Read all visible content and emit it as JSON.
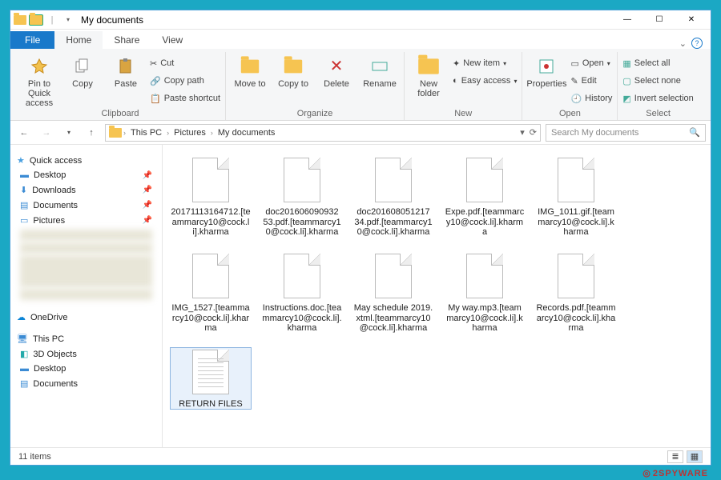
{
  "window": {
    "title": "My documents"
  },
  "tabs": {
    "file": "File",
    "home": "Home",
    "share": "Share",
    "view": "View"
  },
  "ribbon": {
    "clipboard": {
      "label": "Clipboard",
      "pin": "Pin to Quick access",
      "copy": "Copy",
      "paste": "Paste",
      "cut": "Cut",
      "copypath": "Copy path",
      "pasteshort": "Paste shortcut"
    },
    "organize": {
      "label": "Organize",
      "moveto": "Move to",
      "copyto": "Copy to",
      "delete": "Delete",
      "rename": "Rename"
    },
    "new": {
      "label": "New",
      "newfolder": "New folder",
      "newitem": "New item",
      "easyaccess": "Easy access"
    },
    "open": {
      "label": "Open",
      "properties": "Properties",
      "open": "Open",
      "edit": "Edit",
      "history": "History"
    },
    "select": {
      "label": "Select",
      "selectall": "Select all",
      "selectnone": "Select none",
      "invert": "Invert selection"
    }
  },
  "breadcrumb": {
    "seg1": "This PC",
    "seg2": "Pictures",
    "seg3": "My documents"
  },
  "search": {
    "placeholder": "Search My documents"
  },
  "nav": {
    "quick": "Quick access",
    "desktop": "Desktop",
    "downloads": "Downloads",
    "documents": "Documents",
    "pictures": "Pictures",
    "onedrive": "OneDrive",
    "thispc": "This PC",
    "threed": "3D Objects",
    "desktop2": "Desktop",
    "documents2": "Documents"
  },
  "files": [
    "20171113164712.[teammarcy10@cock.li].kharma",
    "doc201606090932 53.pdf.[teammarcy10@cock.li].kharma",
    "doc201608051217 34.pdf.[teammarcy10@cock.li].kharma",
    "Expe.pdf.[teammarcy10@cock.li].kharma",
    "IMG_1011.gif.[teammarcy10@cock.li].kharma",
    "IMG_1527.[teammarcy10@cock.li].kharma",
    "Instructions.doc.[teammarcy10@cock.li].kharma",
    "May schedule 2019.xtml.[teammarcy10@cock.li].kharma",
    "My way.mp3.[teammarcy10@cock.li].kharma",
    "Records.pdf.[teammarcy10@cock.li].kharma",
    "RETURN FILES"
  ],
  "status": {
    "count": "11 items"
  },
  "watermark": "2SPYWARE"
}
